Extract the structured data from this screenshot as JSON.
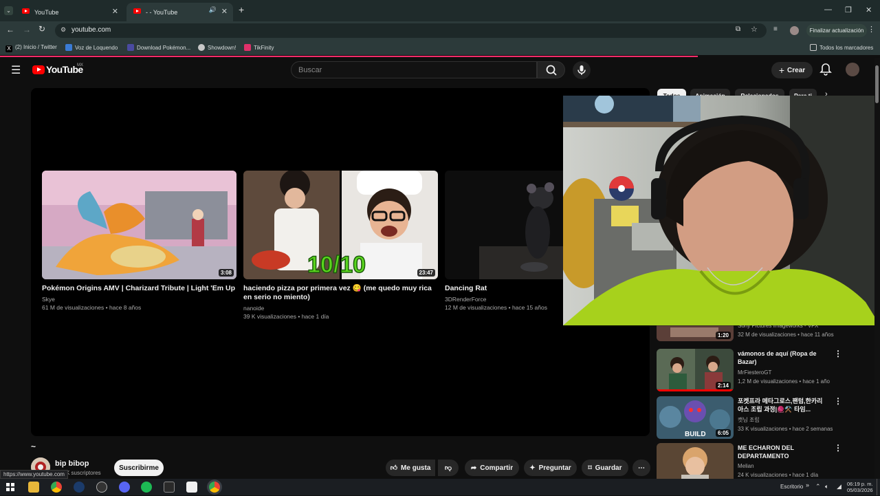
{
  "browser": {
    "tabs": [
      {
        "label": "YouTube"
      },
      {
        "label": "- - YouTube"
      }
    ],
    "url": "youtube.com",
    "update_button": "Finalizar actualización",
    "bookmarks": [
      {
        "label": "(2) Inicio / Twitter",
        "color": "#000000"
      },
      {
        "label": "Voz de Loquendo",
        "color": "#3a7bd5"
      },
      {
        "label": "Download Pokémon...",
        "color": "#4a4aa0"
      },
      {
        "label": "Showdown!",
        "color": "#c8c8c8"
      },
      {
        "label": "TikFinity",
        "color": "#e0306a"
      }
    ],
    "all_bookmarks": "Todos los marcadores",
    "status_url": "https://www.youtube.com"
  },
  "youtube": {
    "logo_text": "YouTube",
    "region": "MX",
    "search_placeholder": "Buscar",
    "create_label": "Crear",
    "accent": "#ff0000"
  },
  "player": {
    "endscreen": [
      {
        "title": "Pokémon Origins AMV | Charizard Tribute | Light 'Em Up",
        "channel": "Skye",
        "meta": "61 M de visualizaciones • hace 8 años",
        "duration": "3:08"
      },
      {
        "title": "haciendo pizza por primera vez 😋 (me quedo muy rica en serio no miento)",
        "channel": "nanoide",
        "meta": "39 K visualizaciones • hace 1 día",
        "duration": "23:47",
        "overlay": "10/10"
      },
      {
        "title": "Dancing Rat",
        "channel": "3DRenderForce",
        "meta": "12 M de visualizaciones • hace 15 años"
      }
    ]
  },
  "video": {
    "title_partial": "~",
    "channel": "bip bibop",
    "subscribers": "K suscriptores",
    "subscribe": "Suscribirme",
    "actions": {
      "like": "Me gusta",
      "share": "Compartir",
      "ask": "Preguntar",
      "save": "Guardar"
    }
  },
  "sidebar": {
    "chips": [
      "Todos",
      "Animación",
      "Relacionados",
      "Para ti"
    ],
    "items": [
      {
        "title": "",
        "channel": "Sony Pictures Imageworks - VFX",
        "meta": "32 M de visualizaciones • hace 11 años",
        "duration": "1:20"
      },
      {
        "title": "vámonos de aquí (Ropa de Bazar)",
        "channel": "MrFiesteroGT",
        "meta": "1,2 M de visualizaciones • hace 1 año",
        "duration": "2:14"
      },
      {
        "title": "포켓프라 메타그로스,팬텀,한카리아스 조립 과정|🧶⚒️ 타임...",
        "channel": "캣님 조립",
        "meta": "33 K visualizaciones • hace 2 semanas",
        "duration": "6:05",
        "overlay": "BUILD"
      },
      {
        "title": "ME ECHARON DEL DEPARTAMENTO",
        "channel": "Melian",
        "meta": "24 K visualizaciones • hace 1 día"
      }
    ]
  },
  "taskbar": {
    "desktop_label": "Escritorio",
    "time": "06:19 p. m.",
    "date": "05/03/2026"
  }
}
